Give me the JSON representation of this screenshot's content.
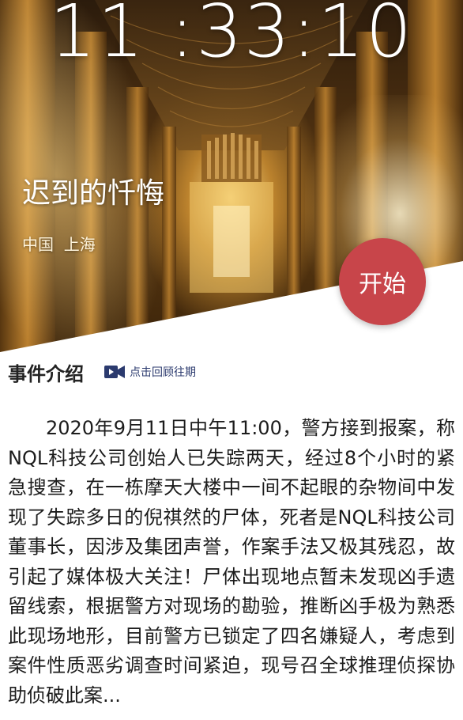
{
  "clock": {
    "time": "11 :33:10"
  },
  "event": {
    "title": "迟到的忏悔",
    "location": "中国  上海",
    "start_label": "开始"
  },
  "intro": {
    "title": "事件介绍",
    "review_label": "点击回顾往期",
    "review_icon": "video-camera-icon",
    "description": "2020年9月11日中午11:00，警方接到报案，称NQL科技公司创始人已失踪两天，经过8个小时的紧急搜查，在一栋摩天大楼中一间不起眼的杂物间中发现了失踪多日的倪祺然的尸体，死者是NQL科技公司董事长，因涉及集团声誉，作案手法又极其残忍，故引起了媒体极大关注！尸体出现地点暂未发现凶手遗留线索，根据警方对现场的勘验，推断凶手极为熟悉此现场地形，目前警方已锁定了四名嫌疑人，考虑到案件性质恶劣调查时间紧迫，现号召全球推理侦探协助侦破此案..."
  },
  "colors": {
    "accent_red": "#c8454a",
    "link_blue": "#2b3a6e"
  }
}
